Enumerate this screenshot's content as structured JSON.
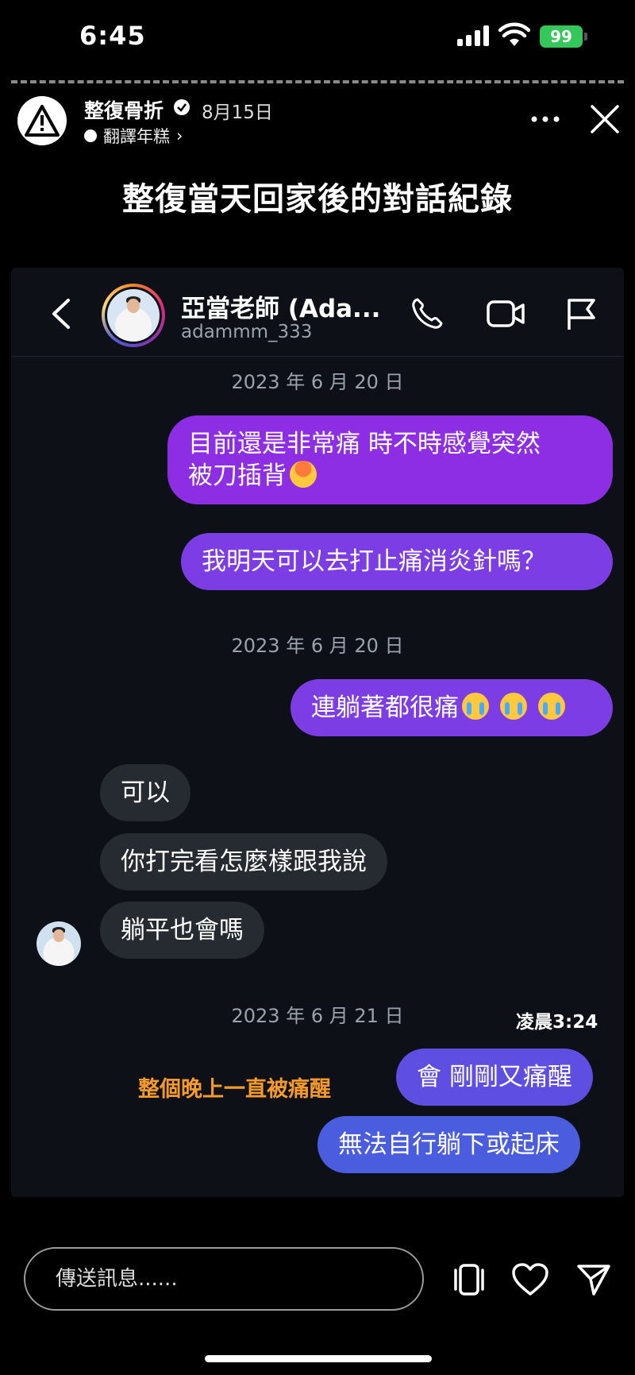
{
  "status_bar": {
    "time": "6:45",
    "battery": "99"
  },
  "story": {
    "username": "整復骨折",
    "date": "8月15日",
    "subtitle": "翻譯年糕",
    "caption": "整復當天回家後的對話紀錄"
  },
  "dm": {
    "contact_name": "亞當老師 (Ada...",
    "contact_handle": "adammm_333",
    "messages": [
      {
        "type": "date",
        "text": "2023 年 6 月 20 日"
      },
      {
        "type": "sent",
        "text1": "目前還是非常痛 時不時感覺突然",
        "text2": "被刀插背"
      },
      {
        "type": "sent",
        "text": "我明天可以去打止痛消炎針嗎？"
      },
      {
        "type": "date",
        "text": "2023 年 6 月 20 日"
      },
      {
        "type": "sent",
        "text": "連躺著都很痛"
      },
      {
        "type": "received",
        "text": "可以"
      },
      {
        "type": "received",
        "text": "你打完看怎麼樣跟我說"
      },
      {
        "type": "received",
        "text": "躺平也會嗎"
      },
      {
        "type": "date",
        "text": "2023 年 6 月 21 日"
      },
      {
        "type": "sent",
        "text": "會 剛剛又痛醒"
      },
      {
        "type": "sent",
        "text": "無法自行躺下或起床"
      }
    ],
    "time_note": "凌晨3:24",
    "annotation": "整個晚上一直被痛醒"
  },
  "reply": {
    "placeholder": "傳送訊息......"
  },
  "colors": {
    "sent_purple": "#8e2ee4",
    "sent_blue": "#4a5ddf",
    "received": "#262a31",
    "annotation": "#f59a2b",
    "battery": "#34c759"
  },
  "icons": [
    "warning-icon",
    "verified-icon",
    "more-icon",
    "close-icon",
    "back-icon",
    "phone-icon",
    "video-icon",
    "flag-icon",
    "sticker-icon",
    "heart-icon",
    "send-icon"
  ]
}
